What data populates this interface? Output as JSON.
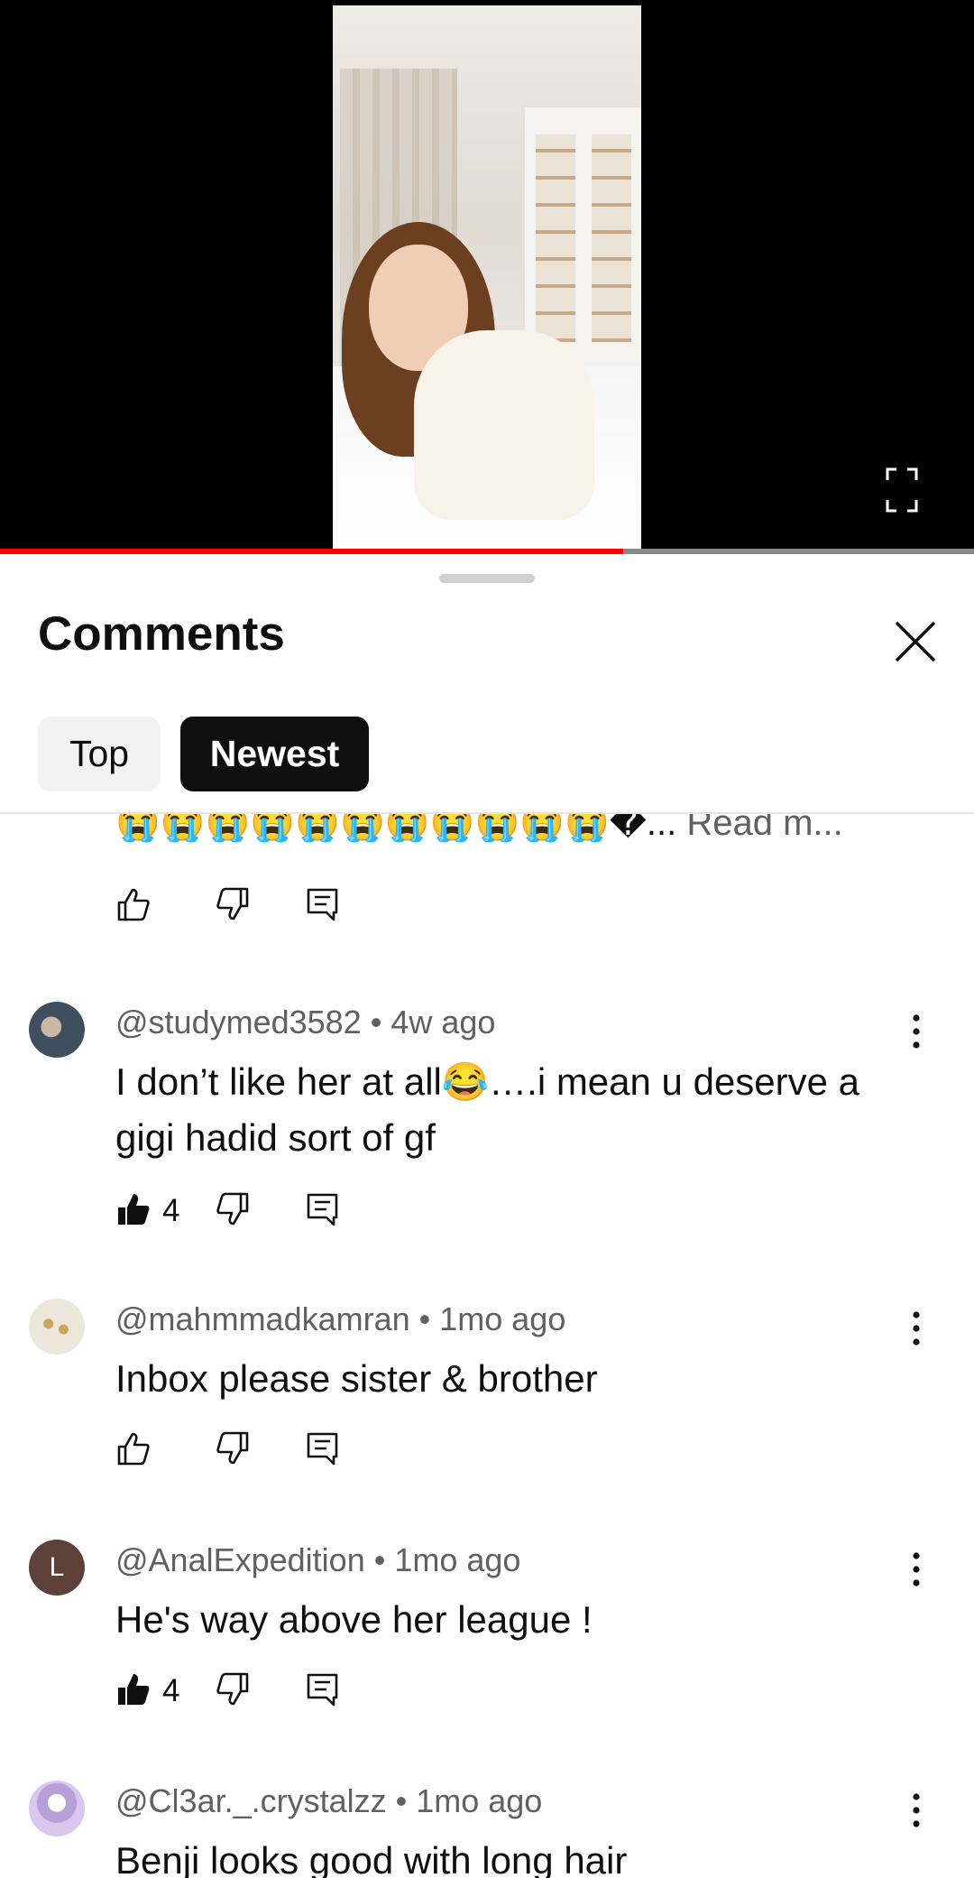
{
  "video": {
    "progress_fraction": 0.64
  },
  "sheet": {
    "title": "Comments",
    "tabs": [
      {
        "label": "Top",
        "selected": false
      },
      {
        "label": "Newest",
        "selected": true
      }
    ]
  },
  "truncated_comment": {
    "emoji": "😭😭😭😭😭😭😭😭😭😭😭",
    "tail": "�...",
    "read_more": "Read m..."
  },
  "comments": [
    {
      "author": "@studymed3582",
      "time": "4w ago",
      "text": "I don’t like her at all😂….i mean u deserve a gigi hadid sort of gf",
      "likes": "4",
      "liked": true,
      "avatar_color": "#4a5a6a"
    },
    {
      "author": "@mahmmadkamran",
      "time": "1mo ago",
      "text": "Inbox please sister & brother",
      "likes": "",
      "liked": false,
      "avatar_color": "#e8e2d0"
    },
    {
      "author": "@AnalExpedition",
      "time": "1mo ago",
      "text": "He's way above her league !",
      "likes": "4",
      "liked": true,
      "avatar_letter": "L",
      "avatar_color": "#5d4037"
    },
    {
      "author": "@Cl3ar._.crystalzz",
      "time": "1mo ago",
      "text": "Benji looks good with long hair",
      "likes": "",
      "liked": false,
      "avatar_color": "#d9c7ee"
    }
  ],
  "meta_separator": " • ",
  "icons": [
    "fullscreen-icon",
    "close-icon",
    "like-icon",
    "dislike-icon",
    "reply-icon",
    "more-vert-icon"
  ],
  "colors": {
    "accent": "#ff0000",
    "text": "#0f0f0f",
    "secondary": "#606060"
  }
}
